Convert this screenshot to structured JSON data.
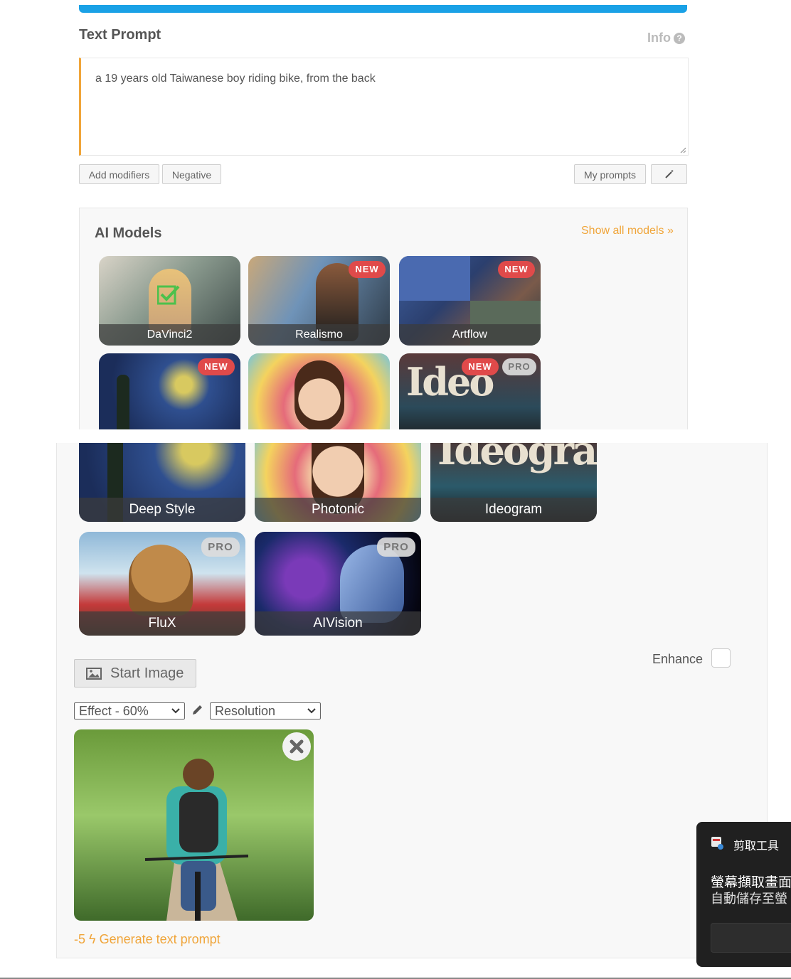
{
  "text_prompt": {
    "title": "Text Prompt",
    "info_label": "Info",
    "value": "a 19 years old Taiwanese boy riding bike, from the back",
    "buttons": {
      "add_modifiers": "Add modifiers",
      "negative": "Negative",
      "my_prompts": "My prompts"
    }
  },
  "ai_models": {
    "title": "AI Models",
    "show_all": "Show all models",
    "models": [
      {
        "name": "DaVinci2",
        "selected": true
      },
      {
        "name": "Realismo",
        "badges": [
          "NEW"
        ]
      },
      {
        "name": "Artflow",
        "badges": [
          "NEW"
        ]
      },
      {
        "name": "Deep Style",
        "badges": [
          "NEW"
        ]
      },
      {
        "name": "Photonic"
      },
      {
        "name": "Ideogram",
        "badges": [
          "NEW",
          "PRO"
        ]
      },
      {
        "name": "FluX",
        "badges": [
          "PRO"
        ]
      },
      {
        "name": "AIVision",
        "badges": [
          "PRO"
        ]
      }
    ],
    "badge_new": "NEW",
    "badge_pro": "PRO"
  },
  "enhance": {
    "label": "Enhance"
  },
  "start_image": {
    "label": "Start Image"
  },
  "controls": {
    "effect": "Effect - 60%",
    "resolution": "Resolution"
  },
  "generate": {
    "cost": "-5",
    "label": "Generate text prompt"
  },
  "toast": {
    "app": "剪取工具",
    "line1": "螢幕擷取畫面",
    "line2": "自動儲存至螢"
  },
  "colors": {
    "accent": "#f0a53a",
    "progress": "#1aa1e6",
    "badge_new": "#e04a4a"
  }
}
